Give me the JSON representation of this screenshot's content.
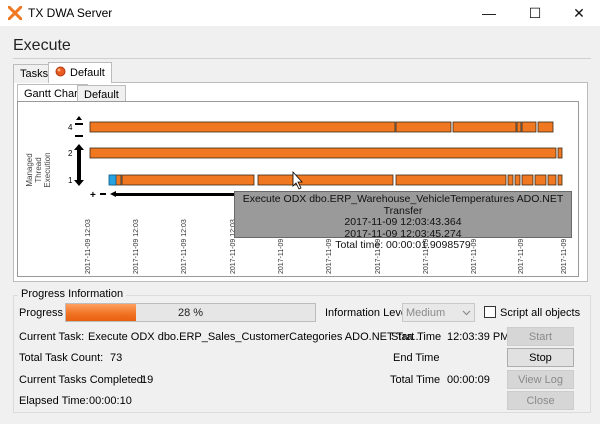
{
  "window": {
    "title": "TX DWA Server",
    "controls": {
      "minimize": "—",
      "maximize": "☐",
      "close": "✕"
    }
  },
  "heading": "Execute",
  "tabs": {
    "outer": [
      "Tasks",
      "Default"
    ],
    "inner": [
      "Gantt Chart",
      "Default"
    ]
  },
  "gantt": {
    "y_axis_label": "Managed\nThread\nExecution",
    "thread_labels": [
      "4",
      "2",
      "1"
    ],
    "x_tick_labels": [
      "2017-11-09 12:03",
      "2017-11-09 12:03",
      "2017-11-09 12:03",
      "2017-11-09 12:03",
      "2017-11-09 12:03",
      "2017-11-09 12:03",
      "2017-11-09 12:03",
      "2017-11-09 12:03",
      "2017-11-09 12:03",
      "2017-11-09 12:03",
      "2017-11-09 12:0"
    ],
    "colors": {
      "task": "#f07820",
      "selected": "#29a3e0",
      "bar_border": "#3a2a1a"
    },
    "tooltip": {
      "line1": "Execute ODX dbo.ERP_Warehouse_VehicleTemperatures ADO.NET Transfer",
      "line2": "2017-11-09 12:03:43.364",
      "line3": "2017-11-09 12:03:45.274",
      "line4": "Total time: 00:00:01.9098579"
    }
  },
  "progress": {
    "legend": "Progress Information",
    "label": "Progress",
    "percent": 28,
    "percent_text": "28 %",
    "info_level_label": "Information Level",
    "info_level_value": "Medium",
    "script_all_label": "Script all objects",
    "current_task_label": "Current Task:",
    "current_task_value": "Execute ODX dbo.ERP_Sales_CustomerCategories ADO.NET Tra...",
    "total_task_label": "Total Task Count:",
    "total_task_value": "73",
    "completed_label": "Current Tasks Completed:",
    "completed_value": "19",
    "elapsed_label": "Elapsed Time:",
    "elapsed_value": "00:00:10",
    "start_time_label": "Start Time",
    "start_time_value": "12:03:39 PM",
    "end_time_label": "End Time",
    "end_time_value": "",
    "total_time_label": "Total Time",
    "total_time_value": "00:00:09"
  },
  "buttons": {
    "start": "Start",
    "stop": "Stop",
    "view_log": "View Log",
    "close": "Close"
  }
}
